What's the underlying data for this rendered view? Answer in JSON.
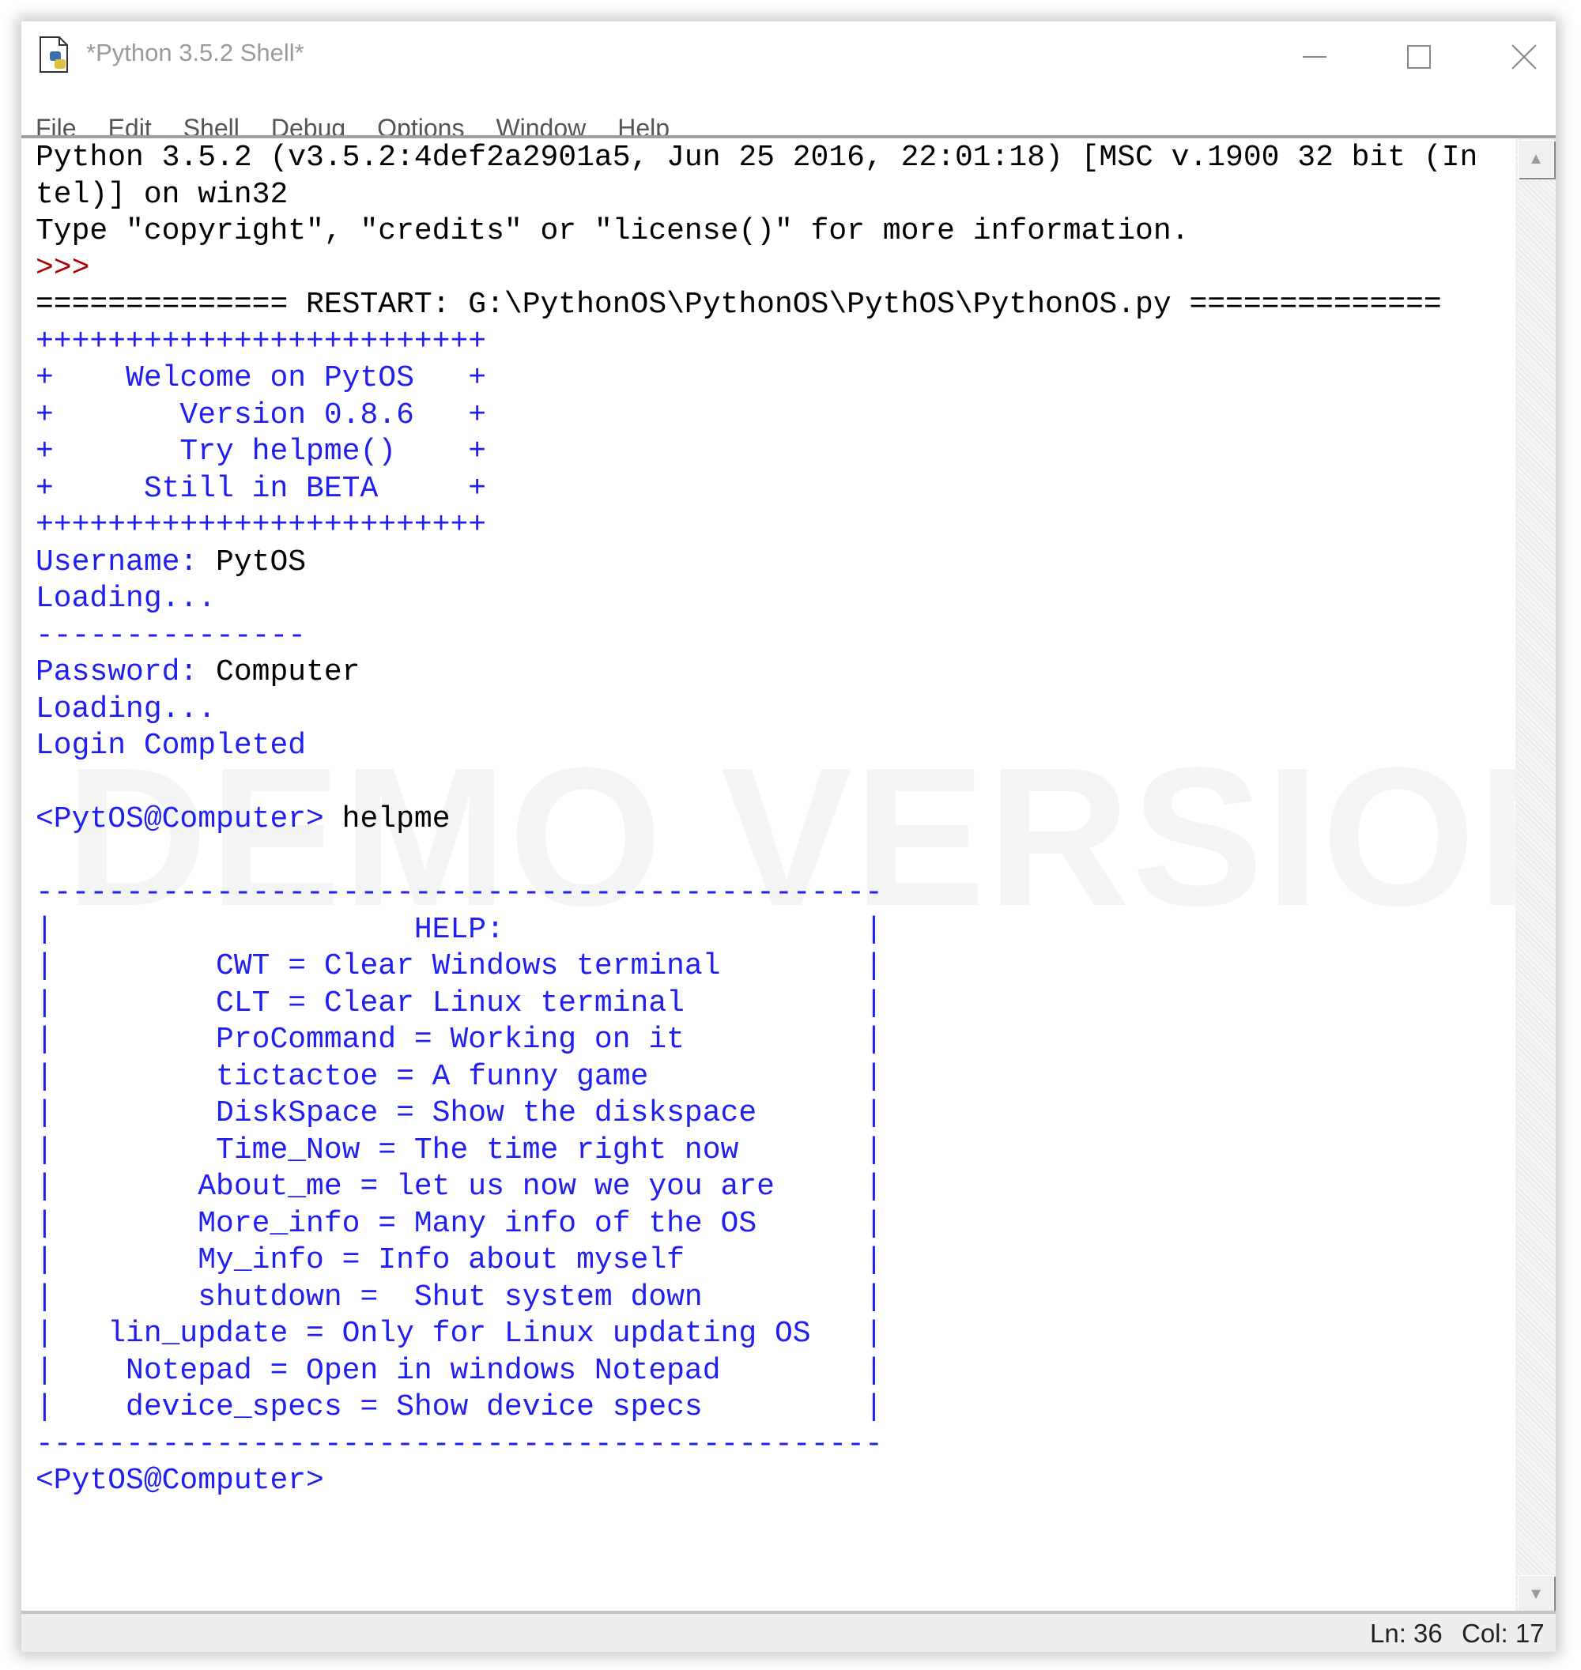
{
  "window": {
    "title": "*Python 3.5.2 Shell*",
    "icon": "python-idle-icon",
    "minimize_icon": "minimize-icon",
    "maximize_icon": "maximize-icon",
    "close_icon": "close-icon"
  },
  "menu": [
    "File",
    "Edit",
    "Shell",
    "Debug",
    "Options",
    "Window",
    "Help"
  ],
  "watermark": "DEMO VERSION",
  "colors": {
    "stdout": "#1f1ff2",
    "stdin": "#000000",
    "prompt": "#b00000"
  },
  "console": {
    "lines": [
      [
        {
          "text": "Python 3.5.2 (v3.5.2:4def2a2901a5, Jun 25 2016, 22:01:18) [MSC v.1900 32 bit (In",
          "kind": "plain"
        }
      ],
      [
        {
          "text": "tel)] on win32",
          "kind": "plain"
        }
      ],
      [
        {
          "text": "Type \"copyright\", \"credits\" or \"license()\" for more information.",
          "kind": "plain"
        }
      ],
      [
        {
          "text": ">>> ",
          "kind": "prompt"
        }
      ],
      [
        {
          "text": "============== RESTART: G:\\PythonOS\\PythonOS\\PythOS\\PythonOS.py ==============",
          "kind": "plain"
        }
      ],
      [
        {
          "text": "+++++++++++++++++++++++++",
          "kind": "out"
        }
      ],
      [
        {
          "text": "+    Welcome on PytOS   +",
          "kind": "out"
        }
      ],
      [
        {
          "text": "+       Version 0.8.6   +",
          "kind": "out"
        }
      ],
      [
        {
          "text": "+       Try helpme()    +",
          "kind": "out"
        }
      ],
      [
        {
          "text": "+     Still in BETA     +",
          "kind": "out"
        }
      ],
      [
        {
          "text": "+++++++++++++++++++++++++",
          "kind": "out"
        }
      ],
      [
        {
          "text": "Username: ",
          "kind": "out"
        },
        {
          "text": "PytOS",
          "kind": "in"
        }
      ],
      [
        {
          "text": "Loading...",
          "kind": "out"
        }
      ],
      [
        {
          "text": "---------------",
          "kind": "out"
        }
      ],
      [
        {
          "text": "Password: ",
          "kind": "out"
        },
        {
          "text": "Computer",
          "kind": "in"
        }
      ],
      [
        {
          "text": "Loading...",
          "kind": "out"
        }
      ],
      [
        {
          "text": "Login Completed",
          "kind": "out"
        }
      ],
      [],
      [
        {
          "text": "<PytOS@Computer> ",
          "kind": "out"
        },
        {
          "text": "helpme",
          "kind": "in"
        }
      ],
      [],
      [
        {
          "text": "-----------------------------------------------",
          "kind": "out"
        }
      ],
      [
        {
          "text": "|                    HELP:",
          "kind": "out",
          "bar": "|"
        }
      ],
      [
        {
          "text": "|         CWT = Clear Windows terminal",
          "kind": "out",
          "bar": "|"
        }
      ],
      [
        {
          "text": "|         CLT = Clear Linux terminal",
          "kind": "out",
          "bar": "|"
        }
      ],
      [
        {
          "text": "|         ProCommand = Working on it",
          "kind": "out",
          "bar": "|"
        }
      ],
      [
        {
          "text": "|         tictactoe = A funny game",
          "kind": "out",
          "bar": "|"
        }
      ],
      [
        {
          "text": "|         DiskSpace = Show the diskspace",
          "kind": "out",
          "bar": "|"
        }
      ],
      [
        {
          "text": "|         Time_Now = The time right now",
          "kind": "out",
          "bar": "|"
        }
      ],
      [
        {
          "text": "|        About_me = let us now we you are",
          "kind": "out",
          "bar": "|"
        }
      ],
      [
        {
          "text": "|        More_info = Many info of the OS",
          "kind": "out",
          "bar": "|"
        }
      ],
      [
        {
          "text": "|        My_info = Info about myself",
          "kind": "out",
          "bar": "|"
        }
      ],
      [
        {
          "text": "|        shutdown =  Shut system down",
          "kind": "out",
          "bar": "|"
        }
      ],
      [
        {
          "text": "|   lin_update = Only for Linux updating OS",
          "kind": "out",
          "bar": "|"
        }
      ],
      [
        {
          "text": "|    Notepad = Open in windows Notepad",
          "kind": "out",
          "bar": "|"
        }
      ],
      [
        {
          "text": "|    device_specs = Show device specs",
          "kind": "out",
          "bar": "|"
        }
      ],
      [
        {
          "text": "-----------------------------------------------",
          "kind": "out"
        }
      ],
      [
        {
          "text": "<PytOS@Computer>",
          "kind": "out"
        }
      ]
    ]
  },
  "scrollbar": {
    "up_icon": "scroll-up-arrow-icon",
    "down_icon": "scroll-down-arrow-icon"
  },
  "status": {
    "line": "Ln: 36",
    "col": "Col: 17"
  }
}
